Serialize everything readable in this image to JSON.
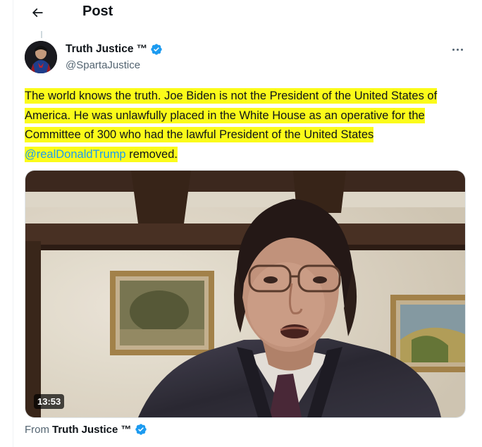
{
  "header": {
    "title": "Post"
  },
  "author": {
    "name": "Truth Justice ™",
    "handle": "@SpartaJustice"
  },
  "tweet": {
    "text_before": "The world knows the truth. Joe Biden is not the President of the United States of America. He was unlawfully placed in the White House as an operative for the Committee of 300 who had the lawful President of the United States ",
    "mention": "@realDonaldTrump",
    "text_after": " removed."
  },
  "media": {
    "duration": "13:53"
  },
  "source": {
    "from_label": "From",
    "from_name": "Truth Justice ™"
  },
  "colors": {
    "accent": "#1d9bf0",
    "highlight": "#fbfb1a",
    "text": "#0f1419",
    "muted": "#536471"
  },
  "icons": {
    "back": "arrow-left-icon",
    "verified": "verified-badge-icon",
    "more": "more-horizontal-icon"
  }
}
